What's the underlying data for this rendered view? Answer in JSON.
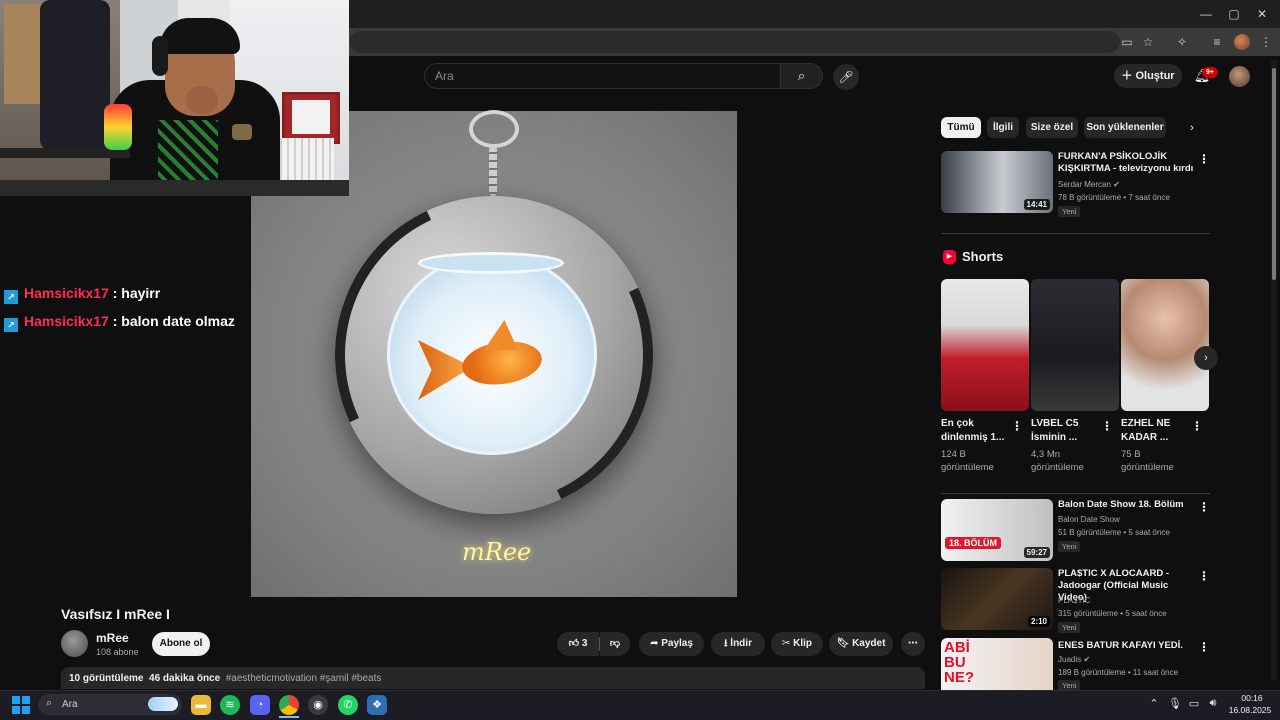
{
  "window": {
    "minimize": "—",
    "restore": "▢",
    "close": "✕"
  },
  "header": {
    "search_placeholder": "Ara",
    "create_label": "Oluştur",
    "notification_badge": "9+"
  },
  "chat": [
    {
      "user": "Hamsicikx17",
      "sep": " : ",
      "message": "hayirr"
    },
    {
      "user": "Hamsicikx17",
      "sep": " : ",
      "message": "balon date olmaz"
    }
  ],
  "video": {
    "signature": "mRee",
    "title": "Vasıfsız I mRee I",
    "channel": "mRee",
    "subscribers": "108 abone",
    "subscribe_label": "Abone ol",
    "like_count": "3",
    "share_label": "Paylaş",
    "download_label": "İndir",
    "clip_label": "Klip",
    "save_label": "Kaydet",
    "views": "10 görüntüleme",
    "age": "46 dakika önce",
    "tags": "#aestheticmotivation #şamil #beats"
  },
  "chips": [
    "Tümü",
    "İlgili",
    "Size özel",
    "Son yüklenenler"
  ],
  "recommendations": [
    {
      "title": "FURKAN'A PSİKOLOJİK KIŞKIRTMA - televizyonu kırdı",
      "channel": "Serdar Mercan",
      "verified": "✔",
      "meta": "78 B görüntüleme • 7 saat önce",
      "badge": "Yeni",
      "duration": "14:41"
    },
    {
      "title": "Balon Date Show 18. Bölüm",
      "channel": "Balon Date Show",
      "verified": "",
      "meta": "51 B görüntüleme • 5 saat önce",
      "badge": "Yeni",
      "duration": "59:27",
      "thumb_text": "18. BÖLÜM"
    },
    {
      "title": "PLA$TIC X ALOCAARD - Jadoogar (Official Music Video)",
      "channel": "PLA$TIC",
      "verified": "",
      "meta": "315 görüntüleme • 5 saat önce",
      "badge": "Yeni",
      "duration": "2:10"
    },
    {
      "title": "ENES BATUR KAFAYI YEDİ.",
      "channel": "Juadis",
      "verified": "✔",
      "meta": "189 B görüntüleme • 11 saat önce",
      "badge": "Yeni",
      "duration": "",
      "thumb_text": "ABİ BU NE?"
    }
  ],
  "shorts": {
    "title": "Shorts",
    "items": [
      {
        "title": "En çok dinlenmiş 1...",
        "views": "124 B görüntüleme"
      },
      {
        "title": "LVBEL C5 İsminin ...",
        "views": "4,3 Mn görüntüleme"
      },
      {
        "title": "EZHEL NE KADAR ...",
        "views": "75 B görüntüleme"
      }
    ]
  },
  "taskbar": {
    "search_placeholder": "Ara",
    "time": "00:16",
    "date": "16.08.2025"
  },
  "colors": {
    "chat_user": "#ff2d55",
    "yt_red": "#ff0033",
    "windows_blue": "#1ea1f2"
  }
}
